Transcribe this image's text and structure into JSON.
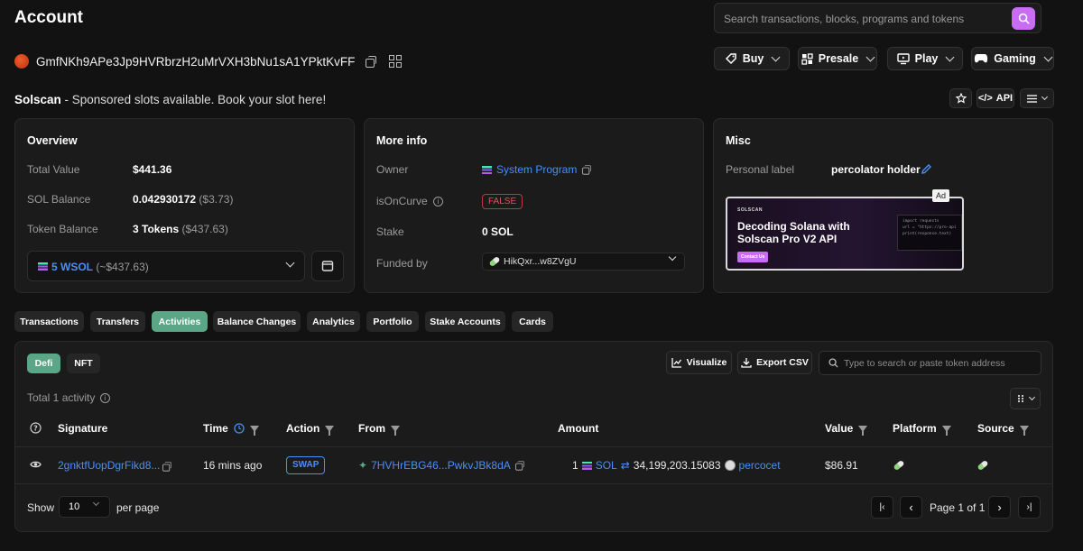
{
  "header": {
    "title": "Account",
    "search_placeholder": "Search transactions, blocks, programs and tokens",
    "nav": [
      {
        "label": "Buy"
      },
      {
        "label": "Presale"
      },
      {
        "label": "Play"
      },
      {
        "label": "Gaming"
      }
    ]
  },
  "account": {
    "address": "GmfNKh9APe3Jp9HVRbrzH2uMrVXH3bNu1sA1YPktKvFF"
  },
  "sponsor": {
    "brand": "Solscan",
    "text": " - Sponsored slots available. Book your slot here!"
  },
  "toolbar": {
    "api_label": "API"
  },
  "overview": {
    "title": "Overview",
    "total_value_label": "Total Value",
    "total_value": "$441.36",
    "sol_balance_label": "SOL Balance",
    "sol_balance": "0.042930172",
    "sol_balance_usd": "($3.73)",
    "token_balance_label": "Token Balance",
    "token_balance": "3 Tokens",
    "token_balance_usd": "($437.63)",
    "selected_token": "5 WSOL",
    "selected_token_usd": "(~$437.63)"
  },
  "more_info": {
    "title": "More info",
    "owner_label": "Owner",
    "owner": "System Program",
    "oncurve_label": "isOnCurve",
    "oncurve": "FALSE",
    "stake_label": "Stake",
    "stake": "0 SOL",
    "funded_label": "Funded by",
    "funded_by": "HikQxr...w8ZVgU"
  },
  "misc": {
    "title": "Misc",
    "personal_label": "Personal label",
    "label_value": "percolator holder",
    "ad_tag": "Ad",
    "ad_brand": "SOLSCAN",
    "ad_heading_1": "Decoding Solana with",
    "ad_heading_2": "Solscan Pro V2 API",
    "ad_cta": "Contact Us",
    "ad_code_1": "import requests",
    "ad_code_2": "url = \"https://pro-api.so",
    "ad_code_3": "print(response.text)"
  },
  "tabs": [
    {
      "label": "Transactions"
    },
    {
      "label": "Transfers"
    },
    {
      "label": "Activities",
      "active": true
    },
    {
      "label": "Balance Changes"
    },
    {
      "label": "Analytics"
    },
    {
      "label": "Portfolio"
    },
    {
      "label": "Stake Accounts"
    },
    {
      "label": "Cards"
    }
  ],
  "activities": {
    "subtabs": [
      {
        "label": "Defi",
        "active": true
      },
      {
        "label": "NFT"
      }
    ],
    "visualize_label": "Visualize",
    "export_label": "Export CSV",
    "token_search_placeholder": "Type to search or paste token address",
    "total_text": "Total 1 activity",
    "columns": [
      "Signature",
      "Time",
      "Action",
      "From",
      "Amount",
      "Value",
      "Platform",
      "Source"
    ],
    "rows": [
      {
        "signature": "2gnktfUopDgrFikd8...",
        "time": "16 mins ago",
        "action": "SWAP",
        "from": "7HVHrEBG46...PwkvJBk8dA",
        "amount_in": "1",
        "token_in": "SOL",
        "amount_out": "34,199,203.15083",
        "token_out": "percocet",
        "value": "$86.91"
      }
    ]
  },
  "pagination": {
    "show_label": "Show",
    "per_page_value": "10",
    "per_page_label": "per page",
    "page_text": "Page 1 of 1"
  },
  "colors": {
    "accent": "#5aa687",
    "link": "#4b8ef7",
    "search_button": "#c86df2",
    "false_red": "#e25555"
  }
}
